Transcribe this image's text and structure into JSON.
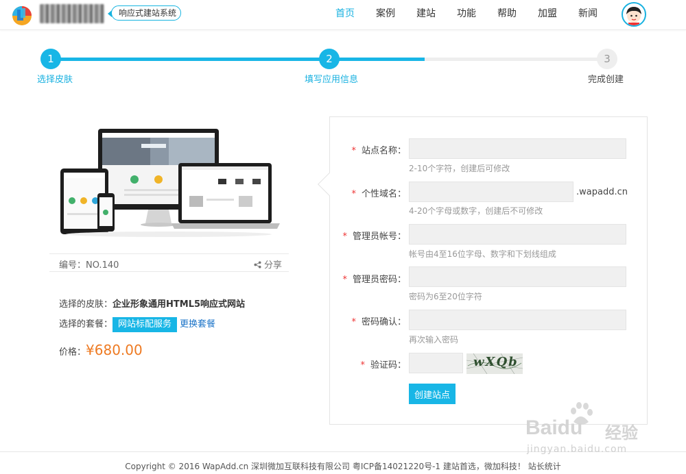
{
  "header": {
    "slogan": "响应式建站系统",
    "nav": [
      "首页",
      "案例",
      "建站",
      "功能",
      "帮助",
      "加盟",
      "新闻"
    ],
    "active_index": 0,
    "accent_color": "#18b1e0"
  },
  "steps": [
    {
      "number": "1",
      "label": "选择皮肤",
      "state": "done"
    },
    {
      "number": "2",
      "label": "填写应用信息",
      "state": "current"
    },
    {
      "number": "3",
      "label": "完成创建",
      "state": "pending"
    }
  ],
  "template": {
    "number": "编号：NO.140",
    "share_label": "分享",
    "skin_prefix": "选择的皮肤：",
    "skin_name": "企业形象通用HTML5响应式网站",
    "package_prefix": "选择的套餐：",
    "package_name": "网站标配服务",
    "change_package": "更换套餐",
    "price_prefix": "价格：",
    "price": "¥680.00",
    "price_color": "#ee7a22"
  },
  "form": {
    "site_name": {
      "label": "站点名称：",
      "value": "",
      "hint": "2-10个字符，创建后可修改"
    },
    "domain": {
      "label": "个性域名：",
      "value": "",
      "suffix": ".wapadd.cn",
      "hint": "4-20个字母或数字，创建后不可修改"
    },
    "admin_account": {
      "label": "管理员帐号：",
      "value": "",
      "hint": "帐号由4至16位字母、数字和下划线组成"
    },
    "admin_password": {
      "label": "管理员密码：",
      "value": "",
      "hint": "密码为6至20位字符"
    },
    "confirm_password": {
      "label": "密码确认：",
      "value": "",
      "hint": "再次输入密码"
    },
    "captcha": {
      "label": "验证码：",
      "value": "",
      "image_text": "wXQb"
    },
    "required_mark": "*",
    "submit_label": "创建站点"
  },
  "footer": {
    "text": "Copyright © 2016 WapAdd.cn 深圳微加互联科技有限公司 粤ICP备14021220号-1 建站首选，微加科技！ 站长统计"
  },
  "watermark": {
    "brand": "Baidu",
    "brand_cn": "经验",
    "url": "jingyan.baidu.com"
  }
}
